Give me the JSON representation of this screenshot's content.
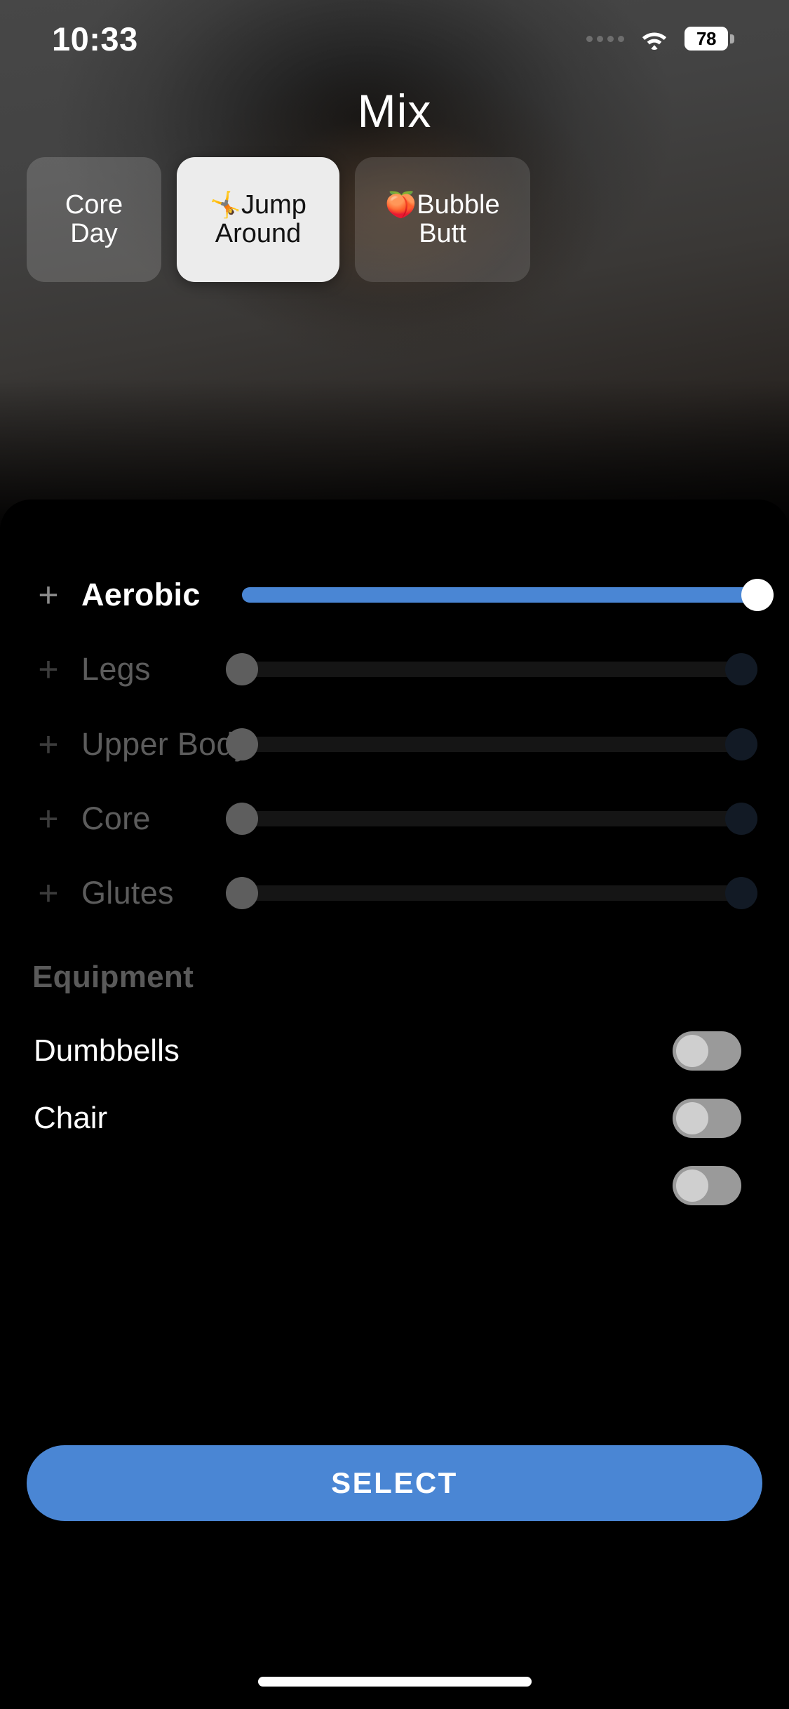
{
  "status_bar": {
    "time": "10:33",
    "battery_percent": "78",
    "wifi_icon": "wifi-icon",
    "signal_dots_icon": "signal-dots-icon",
    "battery_icon": "battery-icon"
  },
  "header": {
    "title": "Mix"
  },
  "workout_cards": [
    {
      "label": "Core Day",
      "emoji": "",
      "selected": false
    },
    {
      "label": "Jump Around",
      "emoji": "🤸",
      "selected": true
    },
    {
      "label": "Bubble Butt",
      "emoji": "🍑",
      "selected": false
    }
  ],
  "sliders": {
    "add_icon": "plus-icon",
    "rows": [
      {
        "label": "Aerobic",
        "value": 100,
        "active": true
      },
      {
        "label": "Legs",
        "value": 0,
        "active": false
      },
      {
        "label": "Upper Body",
        "value": 0,
        "active": false
      },
      {
        "label": "Core",
        "value": 0,
        "active": false
      },
      {
        "label": "Glutes",
        "value": 0,
        "active": false
      }
    ]
  },
  "equipment": {
    "heading": "Equipment",
    "items": [
      {
        "label": "Dumbbells",
        "enabled": false
      },
      {
        "label": "Chair",
        "enabled": false
      }
    ]
  },
  "footer": {
    "select_label": "SELECT"
  },
  "colors": {
    "accent_blue": "#4a86d4",
    "sheet_background": "#000000",
    "selected_card": "#ececec",
    "toggle_off": "#9a9a9a",
    "idle_label": "#5c5c5c"
  }
}
